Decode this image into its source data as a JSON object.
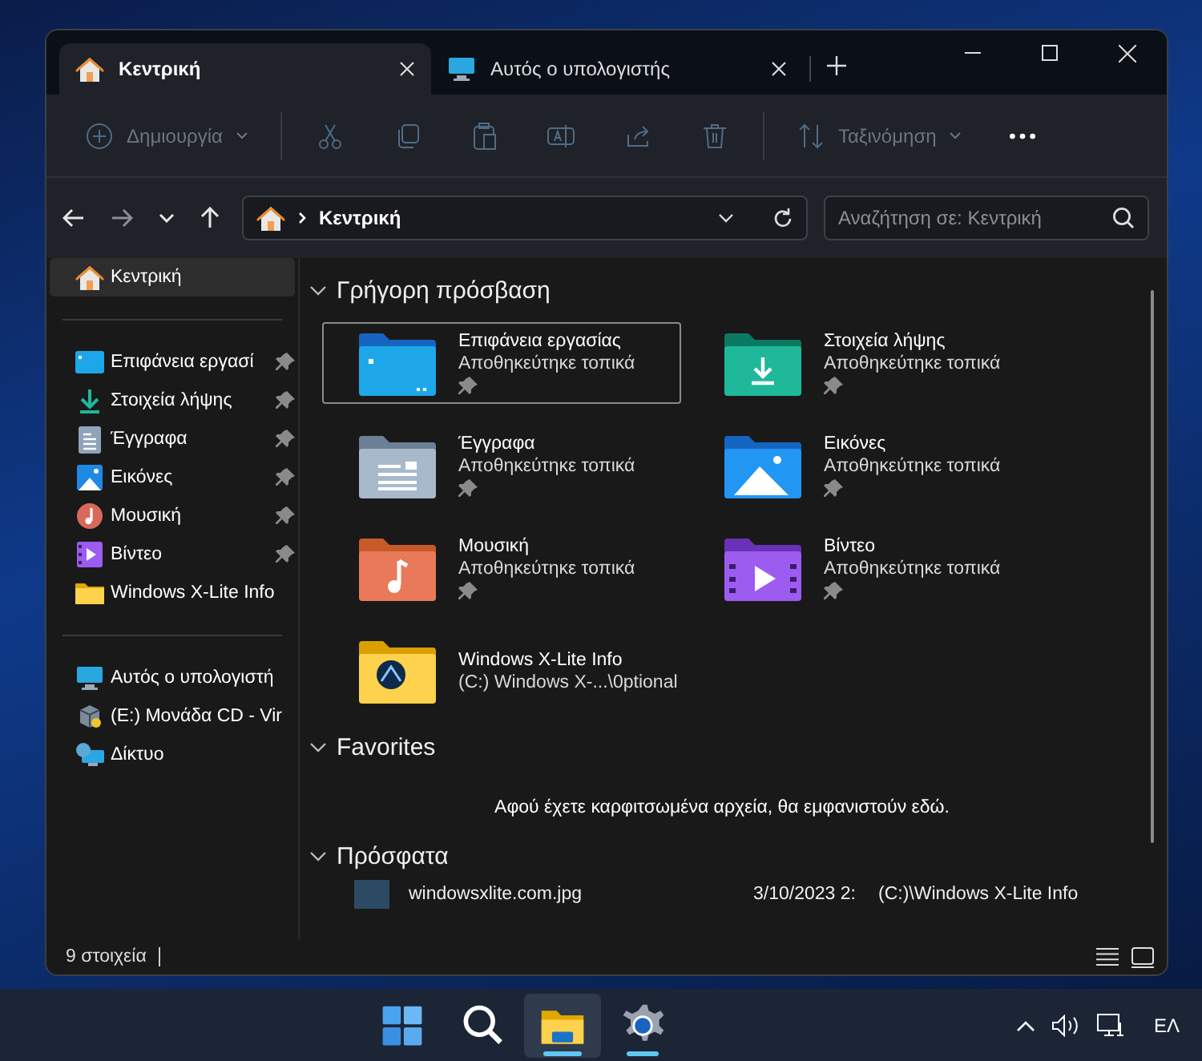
{
  "tabs": [
    {
      "label": "Κεντρική",
      "kind": "home",
      "selected": true
    },
    {
      "label": "Αυτός ο υπολογιστής",
      "kind": "pc",
      "selected": false
    }
  ],
  "toolbar": {
    "items": [
      {
        "kind": "new",
        "label": "Δημιουργία",
        "disabled": true
      },
      {
        "kind": "cut",
        "disabled": true
      },
      {
        "kind": "copy",
        "disabled": true
      },
      {
        "kind": "paste",
        "disabled": true
      },
      {
        "kind": "rename",
        "disabled": true
      },
      {
        "kind": "share",
        "disabled": true
      },
      {
        "kind": "delete",
        "disabled": true
      },
      {
        "kind": "sort",
        "label": "Ταξινόμηση",
        "disabled": true
      },
      {
        "kind": "more",
        "disabled": false
      }
    ]
  },
  "navigation": {
    "forward_disabled": true
  },
  "address": {
    "path": "Κεντρική"
  },
  "search": {
    "placeholder": "Αναζήτηση σε: Κεντρική"
  },
  "sidebar": {
    "sections": [
      {
        "items": [
          {
            "label": "Κεντρική",
            "kind": "home",
            "pinned": false,
            "selected": true
          }
        ]
      },
      {
        "items": [
          {
            "label": "Επιφάνεια εργασί",
            "kind": "desktop",
            "pinned": true,
            "selected": false
          },
          {
            "label": "Στοιχεία λήψης",
            "kind": "download",
            "pinned": true,
            "selected": false
          },
          {
            "label": "Έγγραφα",
            "kind": "documents",
            "pinned": true,
            "selected": false
          },
          {
            "label": "Εικόνες",
            "kind": "pictures",
            "pinned": true,
            "selected": false
          },
          {
            "label": "Μουσική",
            "kind": "music",
            "pinned": true,
            "selected": false
          },
          {
            "label": "Βίντεο",
            "kind": "videos",
            "pinned": true,
            "selected": false
          },
          {
            "label": "Windows X-Lite Info",
            "kind": "folder",
            "pinned": false,
            "selected": false
          }
        ]
      },
      {
        "items": [
          {
            "label": "Αυτός ο υπολογιστή",
            "kind": "pc",
            "pinned": false,
            "selected": false
          },
          {
            "label": "(E:) Μονάδα CD - Vir",
            "kind": "cd",
            "pinned": false,
            "selected": false
          },
          {
            "label": "Δίκτυο",
            "kind": "network",
            "pinned": false,
            "selected": false
          }
        ]
      }
    ]
  },
  "quick_access": {
    "title": "Γρήγορη πρόσβαση",
    "items": [
      {
        "name": "Επιφάνεια εργασίας",
        "subtitle": "Αποθηκεύτηκε τοπικά",
        "kind": "desktop",
        "pinned": true,
        "selected": true
      },
      {
        "name": "Στοιχεία λήψης",
        "subtitle": "Αποθηκεύτηκε τοπικά",
        "kind": "download",
        "pinned": true,
        "selected": false
      },
      {
        "name": "Έγγραφα",
        "subtitle": "Αποθηκεύτηκε τοπικά",
        "kind": "documents",
        "pinned": true,
        "selected": false
      },
      {
        "name": "Εικόνες",
        "subtitle": "Αποθηκεύτηκε τοπικά",
        "kind": "pictures",
        "pinned": true,
        "selected": false
      },
      {
        "name": "Μουσική",
        "subtitle": "Αποθηκεύτηκε τοπικά",
        "kind": "music",
        "pinned": true,
        "selected": false
      },
      {
        "name": "Βίντεο",
        "subtitle": "Αποθηκεύτηκε τοπικά",
        "kind": "videos",
        "pinned": true,
        "selected": false
      },
      {
        "name": "Windows X-Lite Info",
        "subtitle": "(C:) Windows X-...\\0ptional",
        "kind": "folder",
        "pinned": false,
        "selected": false
      }
    ]
  },
  "favorites": {
    "title": "Favorites",
    "message": "Αφού έχετε καρφιτσωμένα αρχεία, θα εμφανιστούν εδώ."
  },
  "recent": {
    "title": "Πρόσφατα",
    "items": [
      {
        "name": "windowsxlite.com.jpg",
        "date": "3/10/2023 2:",
        "location": "(C:)\\Windows X-Lite Info"
      }
    ]
  },
  "status_bar": {
    "count": "9 στοιχεία"
  },
  "taskbar": {
    "items": [
      {
        "kind": "start",
        "selected": false,
        "running": false
      },
      {
        "kind": "search",
        "selected": false,
        "running": false
      },
      {
        "kind": "explorer",
        "selected": true,
        "running": true
      },
      {
        "kind": "settings",
        "selected": false,
        "running": true
      }
    ],
    "language": "ΕΛ"
  }
}
